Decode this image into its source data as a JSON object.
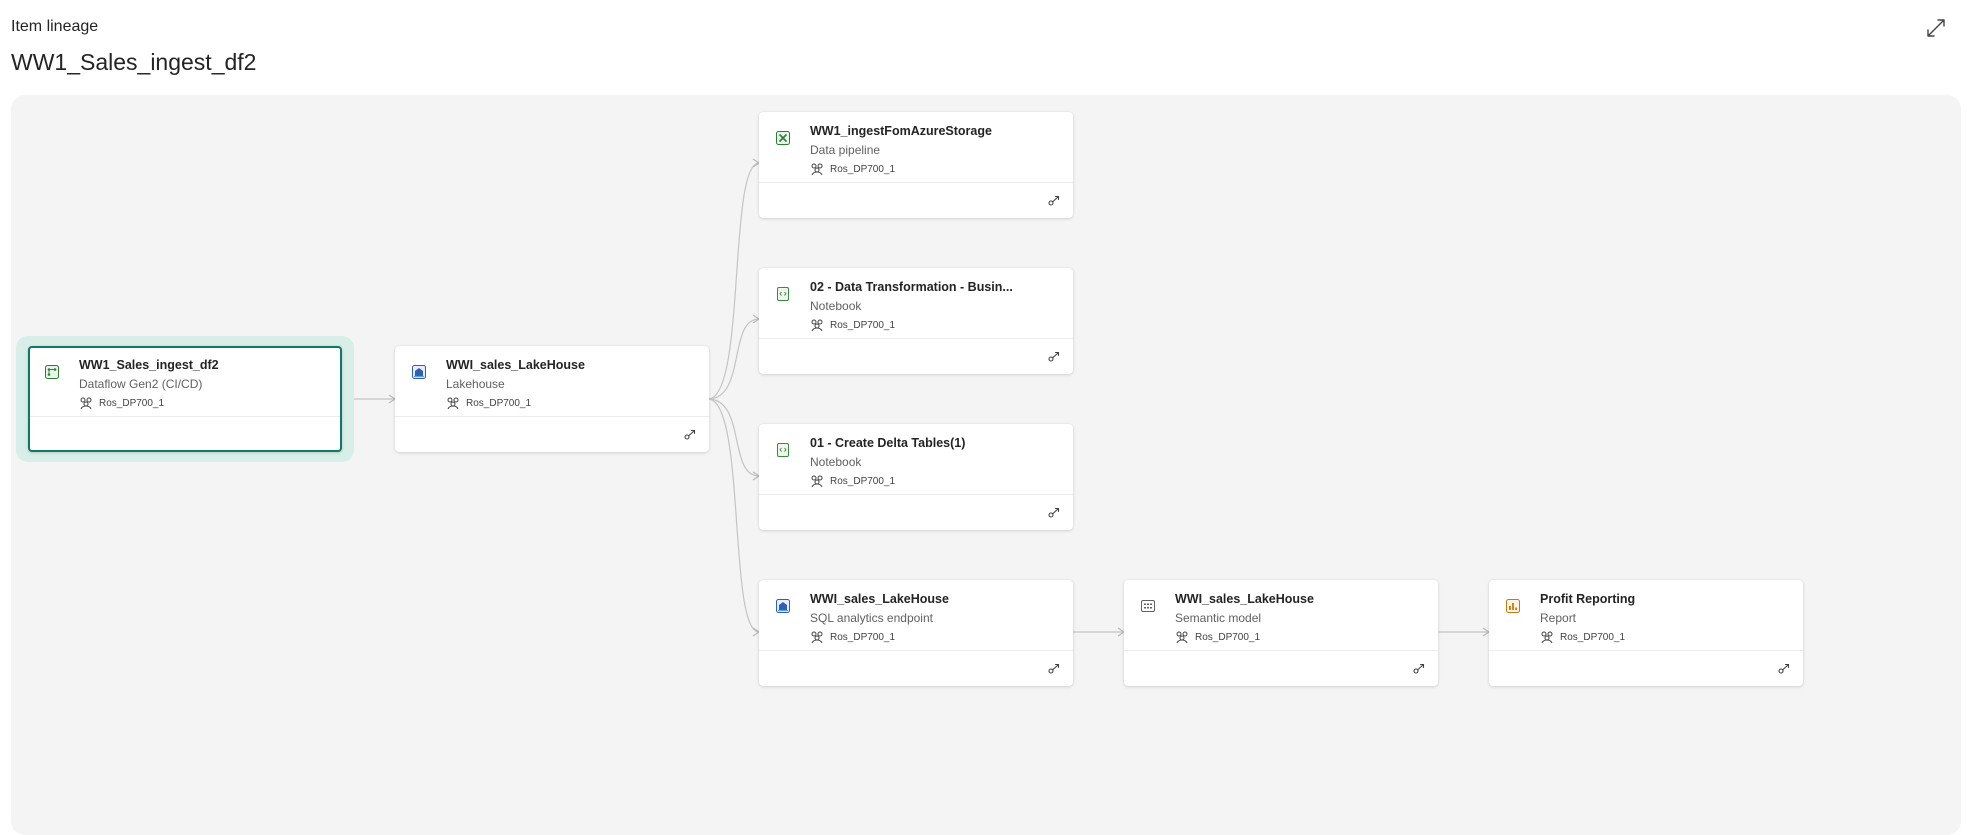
{
  "header": {
    "section_label": "Item lineage",
    "item_title": "WW1_Sales_ingest_df2",
    "expand_icon": "expand-diagonal-icon"
  },
  "colors": {
    "selected_border": "#117865",
    "selected_halo": "#d7efe8",
    "canvas_background": "#f4f4f4",
    "edge": "#c4c4c4"
  },
  "nodes": [
    {
      "id": "dataflow",
      "name": "WW1_Sales_ingest_df2",
      "type": "Dataflow Gen2 (CI/CD)",
      "workspace": "Ros_DP700_1",
      "icon": "dataflow-icon",
      "selected": true,
      "has_impact_action": false
    },
    {
      "id": "lakehouse",
      "name": "WWI_sales_LakeHouse",
      "type": "Lakehouse",
      "workspace": "Ros_DP700_1",
      "icon": "lakehouse-icon",
      "selected": false,
      "has_impact_action": true
    },
    {
      "id": "pipeline",
      "name": "WW1_ingestFomAzureStorage",
      "type": "Data pipeline",
      "workspace": "Ros_DP700_1",
      "icon": "pipeline-icon",
      "selected": false,
      "has_impact_action": true
    },
    {
      "id": "notebook2",
      "name": "02 - Data Transformation - Busin...",
      "type": "Notebook",
      "workspace": "Ros_DP700_1",
      "icon": "notebook-icon",
      "selected": false,
      "has_impact_action": true
    },
    {
      "id": "notebook1",
      "name": "01 - Create Delta Tables(1)",
      "type": "Notebook",
      "workspace": "Ros_DP700_1",
      "icon": "notebook-icon",
      "selected": false,
      "has_impact_action": true
    },
    {
      "id": "sqlendpoint",
      "name": "WWI_sales_LakeHouse",
      "type": "SQL analytics endpoint",
      "workspace": "Ros_DP700_1",
      "icon": "sql-endpoint-icon",
      "selected": false,
      "has_impact_action": true
    },
    {
      "id": "semantic",
      "name": "WWI_sales_LakeHouse",
      "type": "Semantic model",
      "workspace": "Ros_DP700_1",
      "icon": "semantic-model-icon",
      "selected": false,
      "has_impact_action": true
    },
    {
      "id": "report",
      "name": "Profit Reporting",
      "type": "Report",
      "workspace": "Ros_DP700_1",
      "icon": "report-icon",
      "selected": false,
      "has_impact_action": true
    }
  ],
  "edges": [
    {
      "from": "dataflow",
      "to": "lakehouse"
    },
    {
      "from": "lakehouse",
      "to": "pipeline"
    },
    {
      "from": "lakehouse",
      "to": "notebook2"
    },
    {
      "from": "lakehouse",
      "to": "notebook1"
    },
    {
      "from": "lakehouse",
      "to": "sqlendpoint"
    },
    {
      "from": "sqlendpoint",
      "to": "semantic"
    },
    {
      "from": "semantic",
      "to": "report"
    }
  ]
}
